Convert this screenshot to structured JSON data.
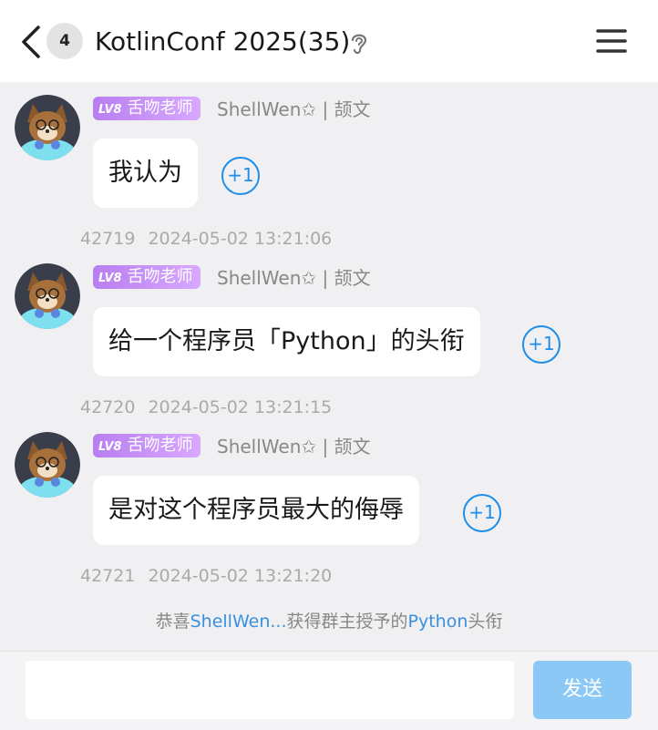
{
  "header": {
    "count_badge": "4",
    "title": "KotlinConf 2025(35)"
  },
  "messages": [
    {
      "level": "LV8",
      "title_badge": "舌吻老师",
      "sender": "ShellWen✩ | 颉文",
      "text": "我认为",
      "plus_one": "+1",
      "id": "42719",
      "time": "2024-05-02 13:21:06"
    },
    {
      "level": "LV8",
      "title_badge": "舌吻老师",
      "sender": "ShellWen✩ | 颉文",
      "text": "给一个程序员「Python」的头衔",
      "plus_one": "+1",
      "id": "42720",
      "time": "2024-05-02 13:21:15"
    },
    {
      "level": "LV8",
      "title_badge": "舌吻老师",
      "sender": "ShellWen✩ | 颉文",
      "text": "是对这个程序员最大的侮辱",
      "plus_one": "+1",
      "id": "42721",
      "time": "2024-05-02 13:21:20"
    }
  ],
  "notice": {
    "prefix": "恭喜",
    "user": "ShellWen...",
    "middle": "获得群主授予的",
    "title": "Python",
    "suffix": "头衔"
  },
  "input_bar": {
    "placeholder": "",
    "send_label": "发送"
  }
}
